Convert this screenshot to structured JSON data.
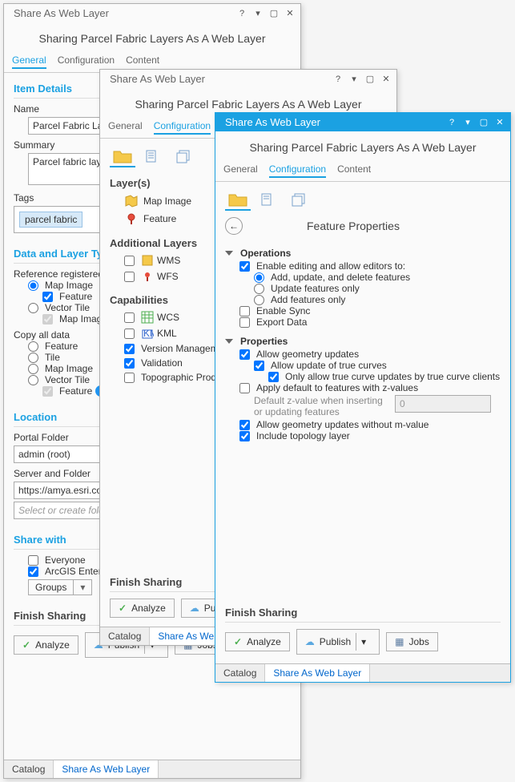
{
  "windowTitle": "Share As Web Layer",
  "subtitle": "Sharing Parcel Fabric Layers As A Web Layer",
  "tabs": {
    "general": "General",
    "configuration": "Configuration",
    "content": "Content"
  },
  "general": {
    "itemDetails": "Item Details",
    "nameLabel": "Name",
    "nameValue": "Parcel Fabric Layer",
    "summaryLabel": "Summary",
    "summaryValue": "Parcel fabric layers",
    "tagsLabel": "Tags",
    "tagValue": "parcel fabric",
    "dataLayerType": "Data and Layer Type",
    "refRegistered": "Reference registered data",
    "mapImage": "Map Image",
    "feature": "Feature",
    "vectorTile": "Vector Tile",
    "tile": "Tile",
    "copyAll": "Copy all data",
    "location": "Location",
    "portalFolder": "Portal Folder",
    "portalFolderValue": "admin (root)",
    "serverFolder": "Server and Folder",
    "serverFolderValue": "https://amya.esri.com",
    "selectCreate": "Select or create folder",
    "shareWith": "Share with",
    "everyone": "Everyone",
    "arcgisEnterprise": "ArcGIS Enterprise",
    "groups": "Groups",
    "finishSharing": "Finish Sharing",
    "analyze": "Analyze",
    "publish": "Publish",
    "jobs": "Jobs",
    "catalog": "Catalog",
    "shareAsWebLayer": "Share As Web Layer"
  },
  "config": {
    "layers": "Layer(s)",
    "mapImage": "Map Image",
    "feature": "Feature",
    "additionalLayers": "Additional Layers",
    "wms": "WMS",
    "wfs": "WFS",
    "capabilities": "Capabilities",
    "wcs": "WCS",
    "kml": "KML",
    "versionMgmt": "Version Management",
    "validation": "Validation",
    "topoProd": "Topographic Production"
  },
  "featureProps": {
    "title": "Feature Properties",
    "operations": "Operations",
    "enableEditing": "Enable editing and allow editors to:",
    "addUpdateDelete": "Add, update, and delete features",
    "updateOnly": "Update features only",
    "addOnly": "Add features only",
    "enableSync": "Enable Sync",
    "exportData": "Export Data",
    "properties": "Properties",
    "allowGeom": "Allow geometry updates",
    "allowTrueCurves": "Allow update of true curves",
    "onlyTrueCurve": "Only allow true curve updates by true curve clients",
    "applyDefaultZ": "Apply default to features with z-values",
    "defaultZLabel": "Default z-value when inserting or updating features",
    "defaultZValue": "0",
    "allowMValue": "Allow geometry updates without m-value",
    "includeTopology": "Include topology layer"
  }
}
